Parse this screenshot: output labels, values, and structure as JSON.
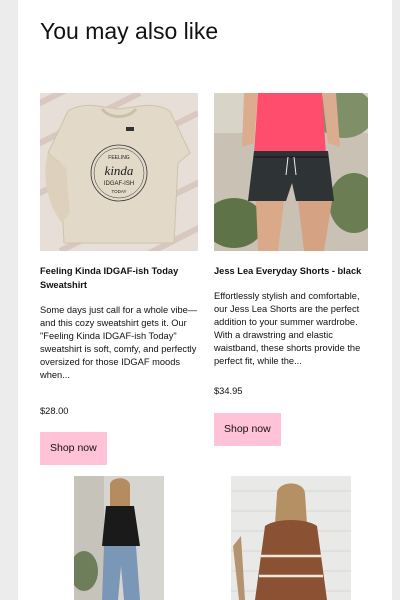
{
  "section": {
    "heading": "You may also like"
  },
  "products": [
    {
      "title": "Feeling Kinda IDGAF-ish Today Sweatshirt",
      "description": "Some days just call for a whole vibe—and this cozy sweatshirt gets it. Our \"Feeling Kinda IDGAF-ish Today\" sweatshirt is soft, comfy, and perfectly oversized for those IDGAF moods when...",
      "price": "$28.00",
      "button_label": "Shop now",
      "image_text": {
        "top": "FEELING",
        "script": "kinda",
        "middle": "IDGAF-ISH",
        "bottom": "TODAY"
      }
    },
    {
      "title": "Jess Lea Everyday Shorts - black",
      "description": "Effortlessly stylish and comfortable, our Jess Lea Shorts are the perfect addition to your summer wardrobe. With a drawstring and elastic waistband, these shorts provide the perfect fit, while the...",
      "price": "$34.95",
      "button_label": "Shop now"
    }
  ],
  "colors": {
    "button_bg": "#ffc2d6",
    "page_bg": "#ececec",
    "card_bg": "#ffffff"
  }
}
